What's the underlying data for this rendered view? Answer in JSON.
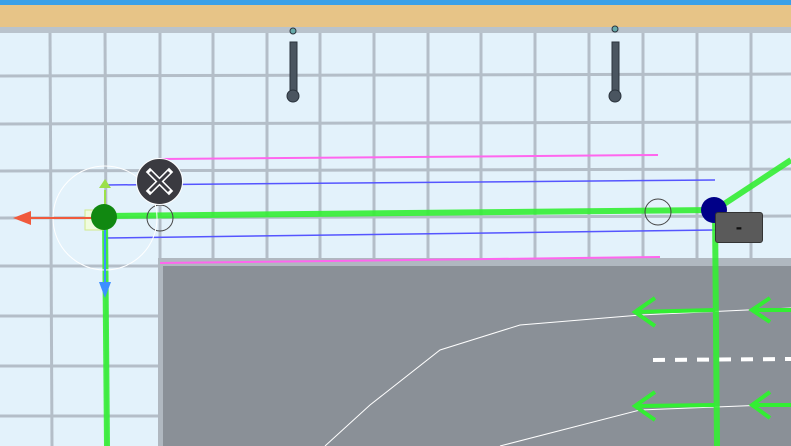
{
  "scene": {
    "colors": {
      "ground": "#e3f2fb",
      "grid": "#b4bec8",
      "road": "#8a9097",
      "path": "#33ee33",
      "guide_blue": "#5555ff",
      "guide_pink": "#ff66ee",
      "node_start": "#118811",
      "node_end": "#000088",
      "axis_x": "#f05a3c",
      "axis_y": "#9be04a",
      "axis_z": "#3d8fff"
    },
    "icons": {
      "delete": "close-x-icon",
      "gizmo": "move-gizmo-icon",
      "lamp": "street-lamp-icon",
      "direction": "arrow-left-icon"
    },
    "minus_button_label": "-"
  }
}
